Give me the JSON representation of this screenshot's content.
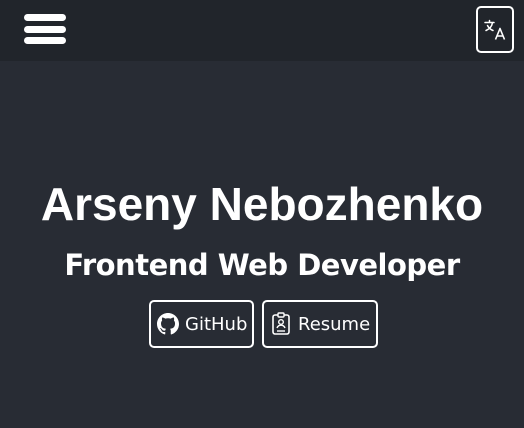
{
  "header": {
    "menu_icon": "hamburger-menu-icon",
    "language_icon": "translate-icon"
  },
  "hero": {
    "name": "Arseny Nebozhenko",
    "role": "Frontend Web Developer",
    "links": [
      {
        "label": "GitHub",
        "icon": "github-icon"
      },
      {
        "label": "Resume",
        "icon": "resume-document-icon"
      }
    ]
  },
  "colors": {
    "background": "#282c34",
    "header": "#21252b",
    "text": "#ffffff"
  }
}
